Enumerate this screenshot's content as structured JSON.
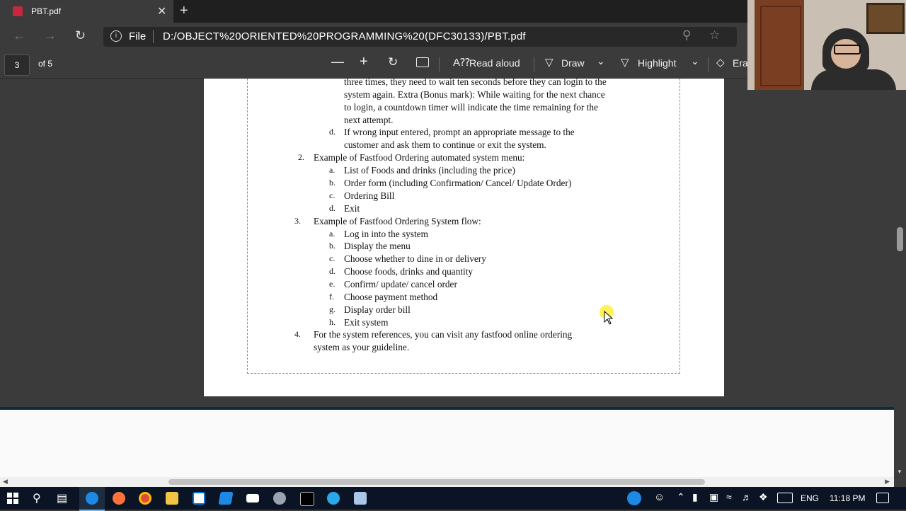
{
  "browser": {
    "tab_title": "PBT.pdf",
    "close_glyph": "✕",
    "newtab_glyph": "+",
    "file_label": "File",
    "url": "D:/OBJECT%20ORIENTED%20PROGRAMMING%20(DFC30133)/PBT.pdf"
  },
  "pdf_toolbar": {
    "page_number": "3",
    "page_total": "of 5",
    "read_aloud": "Read aloud",
    "draw": "Draw",
    "highlight": "Highlight",
    "erase": "Eras"
  },
  "doc": {
    "lines": [
      {
        "marker": "",
        "text": "three times, they need to wait ten seconds before they can login to the"
      },
      {
        "marker": "",
        "text": "system again. Extra (Bonus mark): While waiting for the next chance"
      },
      {
        "marker": "",
        "text": "to login, a countdown timer will indicate the time remaining for the"
      },
      {
        "marker": "",
        "text": "next attempt."
      },
      {
        "marker": "d.",
        "text": "If wrong input entered, prompt an appropriate message to the"
      },
      {
        "marker": "",
        "text": "customer and ask them to continue or exit the system."
      },
      {
        "marker": "2.",
        "text": "Example of Fastfood Ordering automated system menu:"
      },
      {
        "marker": "a.",
        "text": "List of Foods and drinks (including the price)"
      },
      {
        "marker": "b.",
        "text": "Order form (including Confirmation/ Cancel/ Update Order)"
      },
      {
        "marker": "c.",
        "text": "Ordering Bill"
      },
      {
        "marker": "d.",
        "text": "Exit"
      },
      {
        "marker": "3.",
        "text": "Example of Fastfood Ordering System flow:"
      },
      {
        "marker": "a.",
        "text": "Log in into the system"
      },
      {
        "marker": "b.",
        "text": "Display the menu"
      },
      {
        "marker": "c.",
        "text": "Choose whether to dine in or delivery"
      },
      {
        "marker": "d.",
        "text": "Choose foods, drinks and quantity"
      },
      {
        "marker": "e.",
        "text": "Confirm/ update/ cancel order"
      },
      {
        "marker": "f.",
        "text": "Choose payment method"
      },
      {
        "marker": "g.",
        "text": "Display order bill"
      },
      {
        "marker": "h.",
        "text": "Exit system"
      },
      {
        "marker": "4.",
        "text": "For the system references, you can visit any fastfood online ordering"
      },
      {
        "marker": "",
        "text": "system as your guideline."
      }
    ]
  },
  "taskbar": {
    "lang": "ENG",
    "time": "11:18 PM"
  },
  "colors": {
    "accent": "#0078d4",
    "dash_border": "#7aa05a"
  }
}
